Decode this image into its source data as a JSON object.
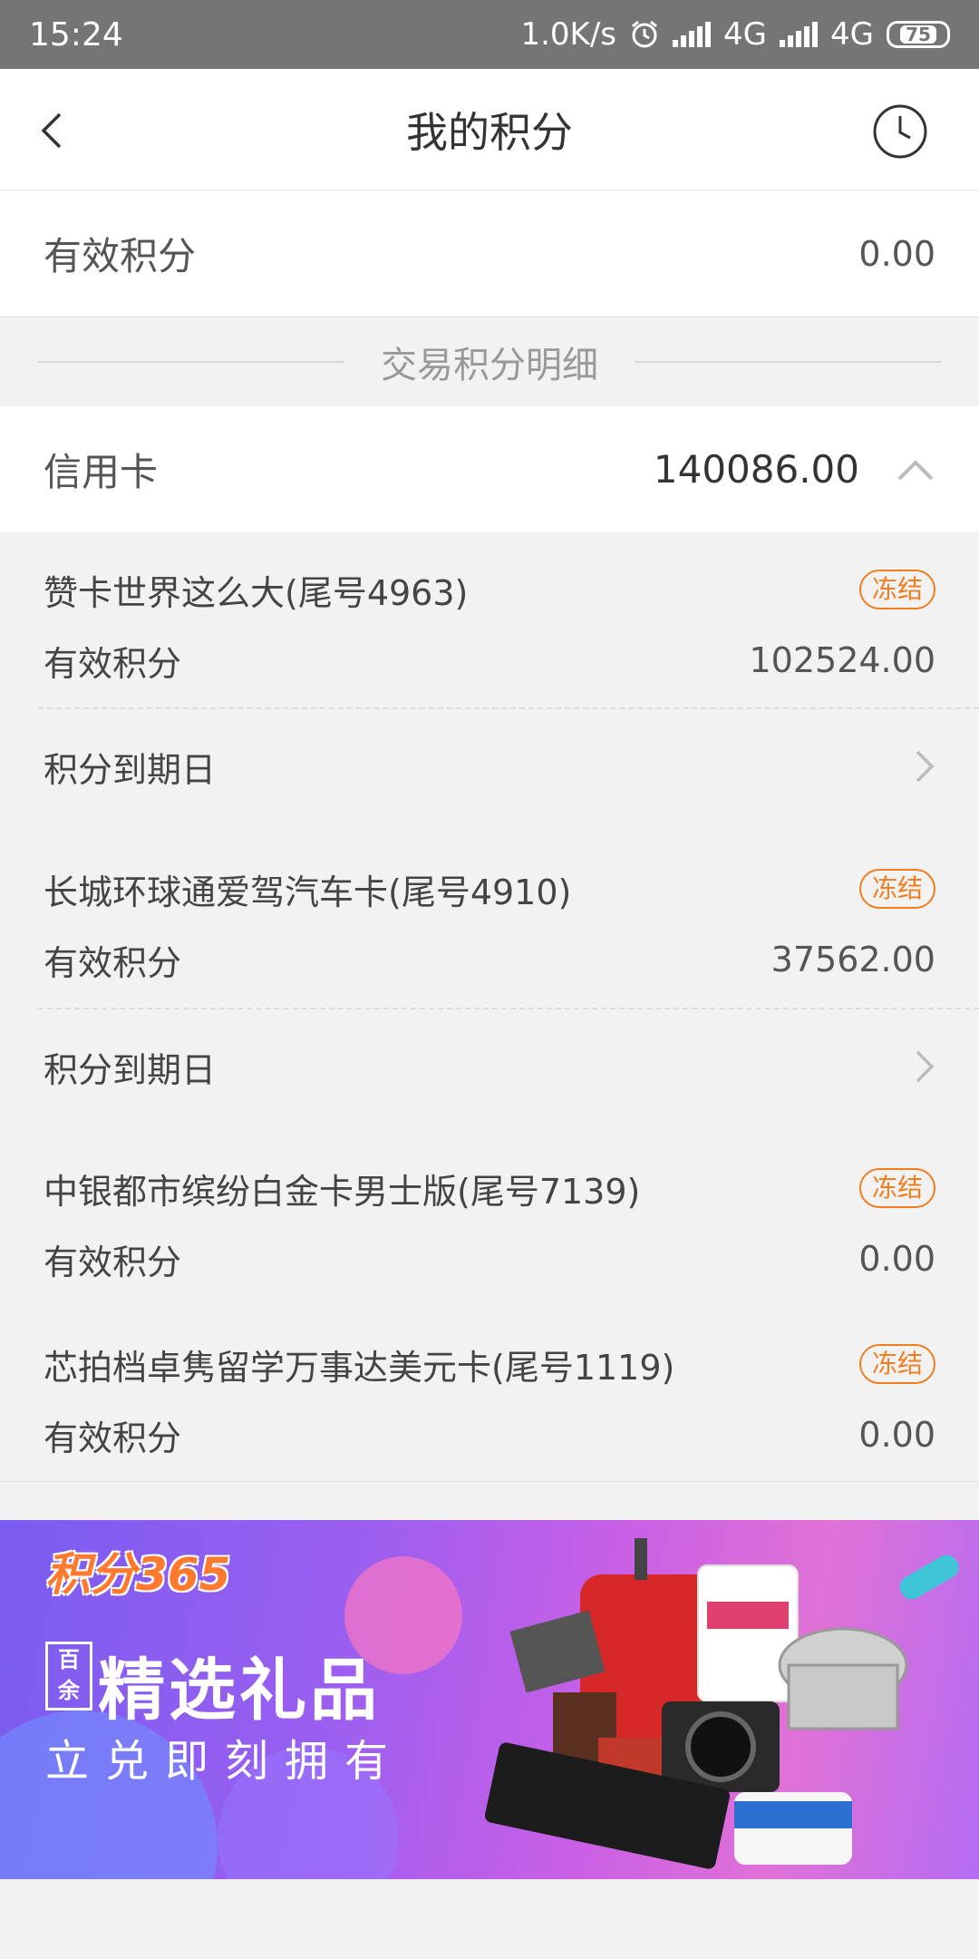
{
  "status_bar": {
    "time": "15:24",
    "speed": "1.0K/s",
    "network1": "4G",
    "network2": "4G",
    "battery": "75"
  },
  "header": {
    "title": "我的积分",
    "back_icon": "chevron-left-icon",
    "history_icon": "clock-icon"
  },
  "summary": {
    "label": "有效积分",
    "value": "0.00"
  },
  "section": {
    "title": "交易积分明细"
  },
  "credit": {
    "label": "信用卡",
    "total": "140086.00",
    "expanded": true
  },
  "cards": [
    {
      "name": "赞卡世界这么大(尾号4963)",
      "badge": "冻结",
      "points_label": "有效积分",
      "points": "102524.00",
      "expiry_label": "积分到期日"
    },
    {
      "name": "长城环球通爱驾汽车卡(尾号4910)",
      "badge": "冻结",
      "points_label": "有效积分",
      "points": "37562.00",
      "expiry_label": "积分到期日"
    },
    {
      "name": "中银都市缤纷白金卡男士版(尾号7139)",
      "badge": "冻结",
      "points_label": "有效积分",
      "points": "0.00"
    },
    {
      "name": "芯拍档卓隽留学万事达美元卡(尾号1119)",
      "badge": "冻结",
      "points_label": "有效积分",
      "points": "0.00"
    }
  ],
  "banner": {
    "brand": "积分365",
    "tag": "百余",
    "headline": "精选礼品",
    "subline": "立兑即刻拥有"
  },
  "colors": {
    "accent": "#f07d1f",
    "statusbar": "#757575"
  }
}
